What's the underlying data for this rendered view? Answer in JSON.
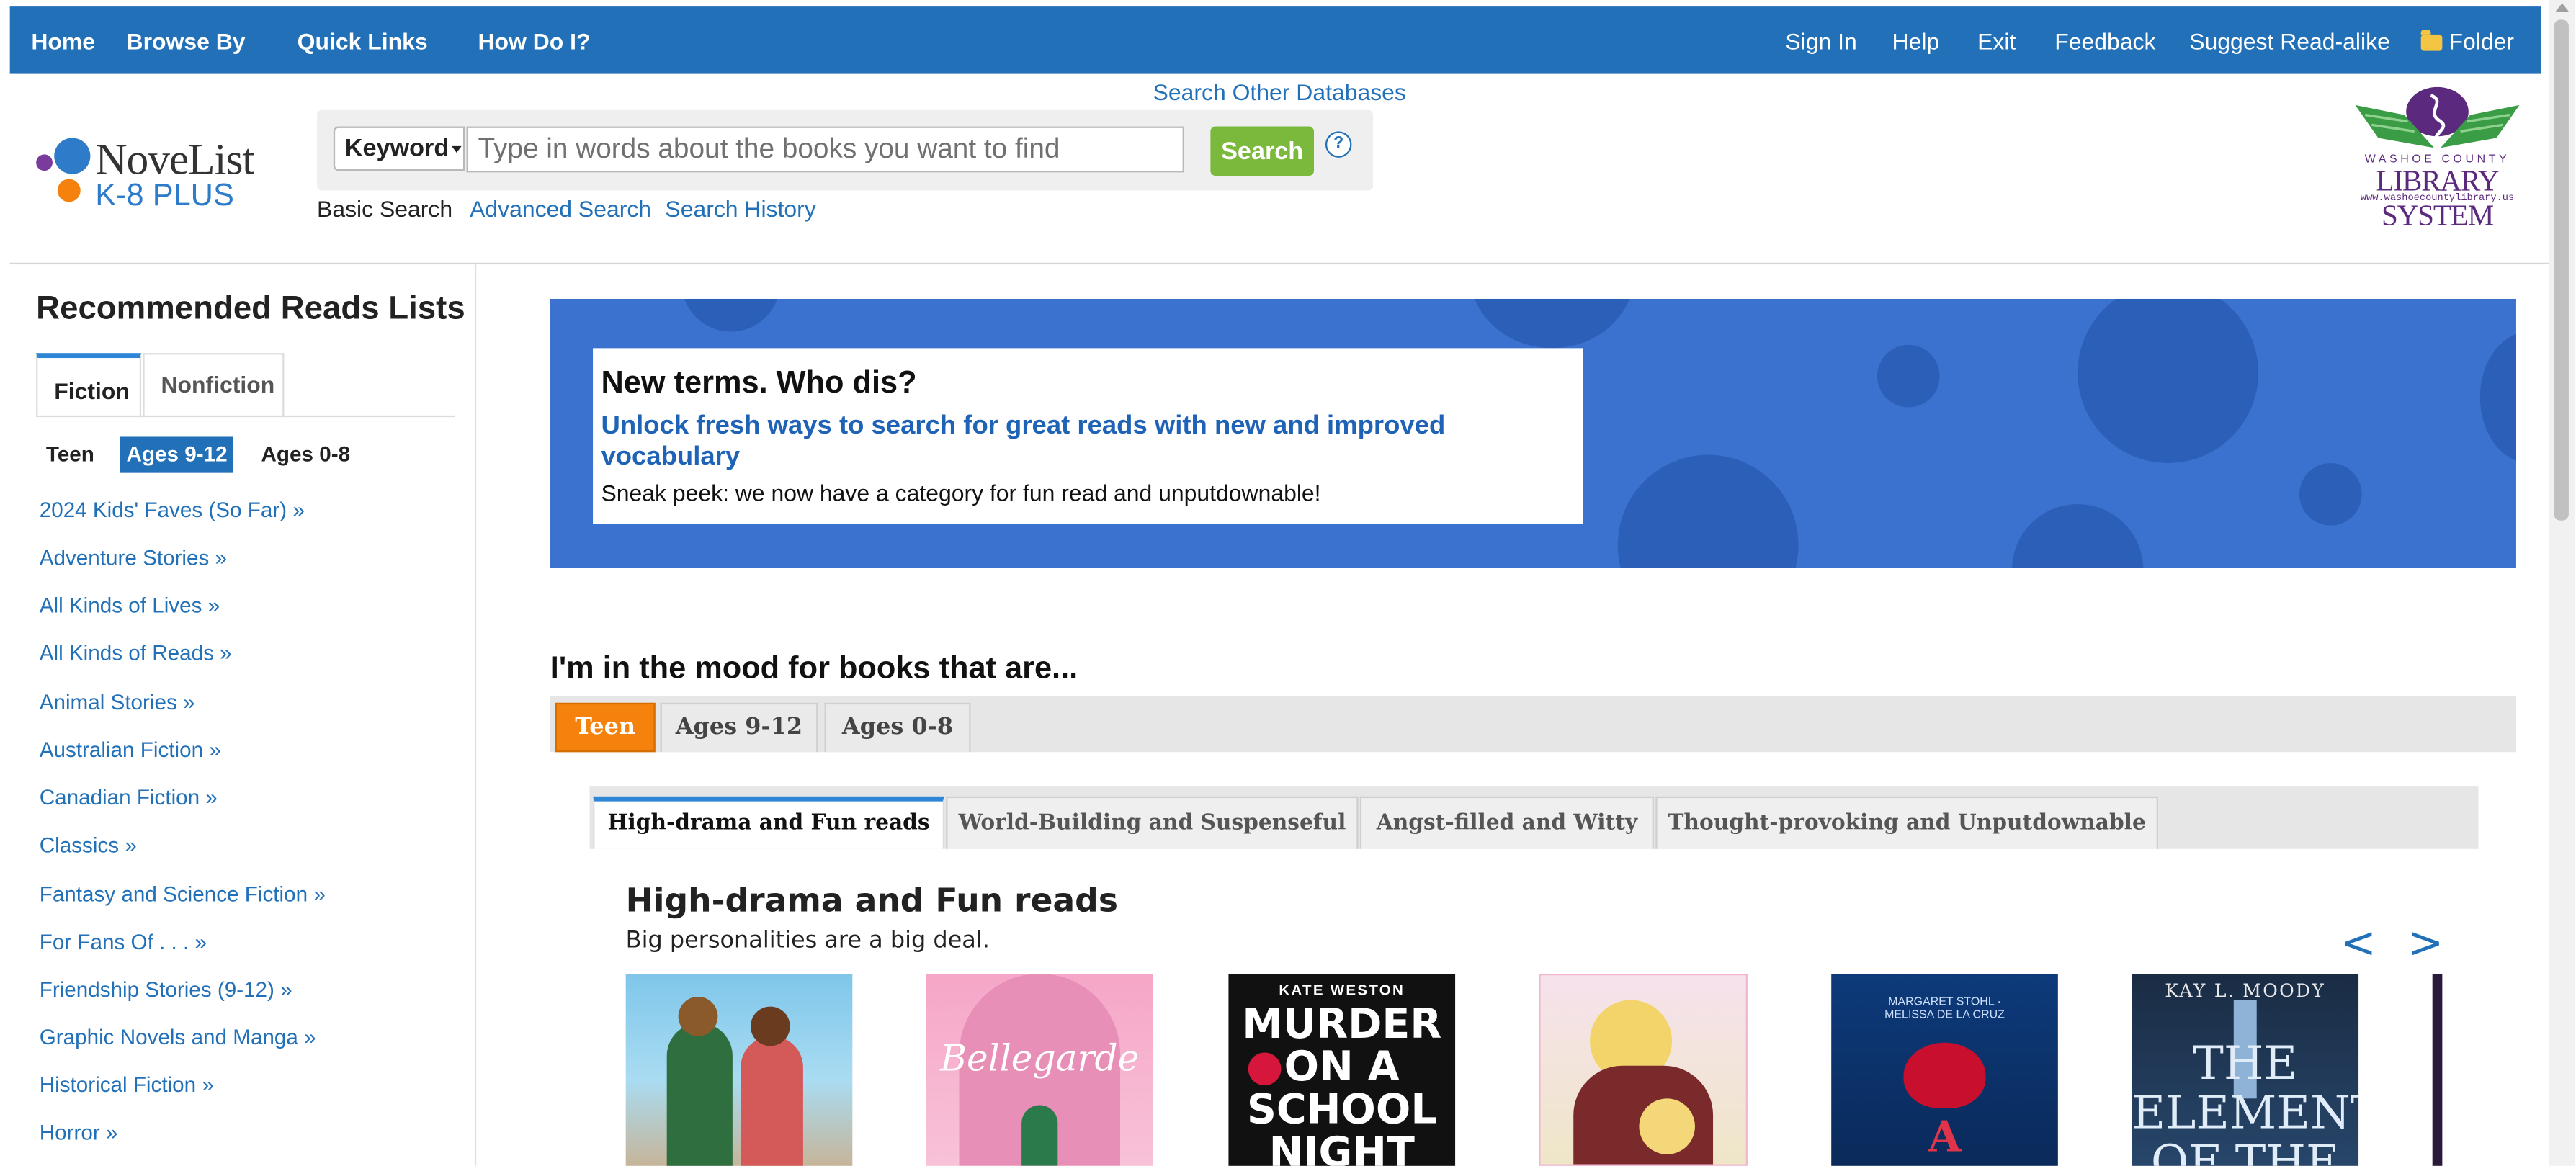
{
  "nav": {
    "left": [
      "Home",
      "Browse By",
      "Quick Links",
      "How Do I?"
    ],
    "right": [
      "Sign In",
      "Help",
      "Exit",
      "Feedback",
      "Suggest Read-alike",
      "Folder"
    ]
  },
  "header": {
    "search_other": "Search Other Databases",
    "logo_name": "NoveList",
    "logo_sub": "K-8 PLUS",
    "search": {
      "field_select": "Keyword",
      "placeholder": "Type in words about the books you want to find",
      "button": "Search",
      "help": "?",
      "tabs": [
        "Basic Search",
        "Advanced Search",
        "Search History"
      ]
    },
    "library_logo": {
      "top": "WASHOE COUNTY",
      "mid": "LIBRARY SYSTEM",
      "url": "www.washoecountylibrary.us"
    }
  },
  "sidebar": {
    "title": "Recommended Reads Lists",
    "tabs": [
      "Fiction",
      "Nonfiction"
    ],
    "ages": [
      "Teen",
      "Ages 9-12",
      "Ages 0-8"
    ],
    "active_age": "Ages 9-12",
    "items": [
      "2024 Kids' Faves (So Far) »",
      "Adventure Stories »",
      "All Kinds of Lives »",
      "All Kinds of Reads »",
      "Animal Stories »",
      "Australian Fiction »",
      "Canadian Fiction »",
      "Classics »",
      "Fantasy and Science Fiction »",
      "For Fans Of . . . »",
      "Friendship Stories (9-12) »",
      "Graphic Novels and Manga »",
      "Historical Fiction »",
      "Horror »"
    ]
  },
  "banner": {
    "title": "New terms. Who dis?",
    "link": "Unlock fresh ways to search for great reads with new and improved vocabulary",
    "text": "Sneak peek: we now have a category for fun read and unputdownable!",
    "bg_color": "#3b72d0"
  },
  "mood": {
    "title": "I'm in the mood for books that are...",
    "age_tabs": [
      "Teen",
      "Ages 9-12",
      "Ages 0-8"
    ],
    "sub_tabs": [
      "High-drama and Fun reads",
      "World-Building and Suspenseful",
      "Angst-filled and Witty",
      "Thought-provoking and Unputdownable"
    ],
    "section_title": "High-drama and Fun reads",
    "section_sub": "Big personalities are a big deal.",
    "prev": "<",
    "next": ">"
  },
  "covers": [
    {
      "title": "",
      "author": ""
    },
    {
      "title": "Bellegarde",
      "author": ""
    },
    {
      "title": "MURDER ON A SCHOOL NIGHT",
      "author": "KATE WESTON"
    },
    {
      "title": "",
      "author": ""
    },
    {
      "title": "A SECRET",
      "author": "MARGARET STOHL · MELISSA DE LA CRUZ"
    },
    {
      "title": "THE ELEMENTS OF THE",
      "author": "KAY L. MOODY"
    }
  ],
  "colors": {
    "nav": "#2170b8",
    "link": "#2170b8",
    "search_button": "#7ab93b",
    "teen_tab": "#f5820d"
  }
}
